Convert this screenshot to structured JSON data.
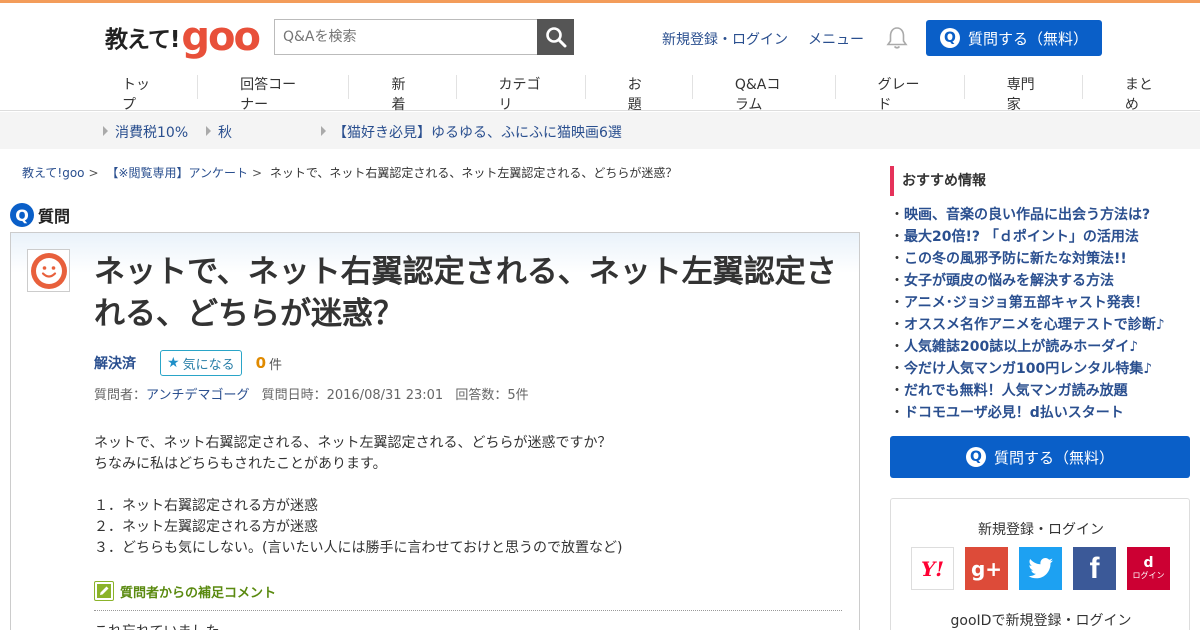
{
  "colors": {
    "accent_orange": "#f39c5a",
    "brand_blue": "#0a5fc8",
    "link": "#2a4f8f",
    "pink_bar": "#e5325a"
  },
  "header": {
    "logo_text": "教えて!",
    "logo_brand": "goo",
    "search_placeholder": "Q&Aを検索",
    "login_link": "新規登録・ログイン",
    "menu_link": "メニュー",
    "ask_button": "質問する（無料）"
  },
  "nav": [
    "トップ",
    "回答コーナー",
    "新着",
    "カテゴリ",
    "お題",
    "Q&Aコラム",
    "グレード",
    "専門家",
    "まとめ"
  ],
  "trend": [
    "消費税10%",
    "秋",
    "【猫好き必見】ゆるゆる、ふにふに猫映画6選"
  ],
  "breadcrumb": {
    "home": "教えて!goo",
    "category": "【※閲覧専用】アンケート",
    "current": "ネットで、ネット右翼認定される、ネット左翼認定される、どちらが迷惑？"
  },
  "question": {
    "section_label": "質問",
    "title": "ネットで、ネット右翼認定される、ネット左翼認定される、どちらが迷惑？",
    "status": "解決済",
    "kininaru_label": "気になる",
    "kininaru_count": "0",
    "kininaru_unit": "件",
    "meta_asker_label": "質問者：",
    "asker": "アンチデマゴーグ",
    "meta_date": "質問日時：2016/08/31 23:01",
    "meta_answers": "回答数：5件",
    "body": "ネットで、ネット右翼認定される、ネット左翼認定される、どちらが迷惑ですか？\nちなみに私はどちらもされたことがあります。\n\n１．ネット右翼認定される方が迷惑\n２．ネット左翼認定される方が迷惑\n３．どちらも気にしない。(言いたい人には勝手に言わせておけと思うので放置など)",
    "supplement_label": "質問者からの補足コメント",
    "supplement_text": "これ忘れていました"
  },
  "sidebar": {
    "recommend_title": "おすすめ情報",
    "recommend": [
      "映画、音楽の良い作品に出会う方法は?",
      "最大20倍!? 「ｄポイント」の活用法",
      "この冬の風邪予防に新たな対策法!!",
      "女子が頭皮の悩みを解決する方法",
      "アニメ･ジョジョ第五部キャスト発表！",
      "オススメ名作アニメを心理テストで診断♪",
      "人気雑誌200誌以上が読みホーダイ♪",
      "今だけ人気マンガ100円レンタル特集♪",
      "だれでも無料！人気マンガ読み放題",
      "ドコモユーザ必見！d払いスタート"
    ],
    "ask_button": "質問する（無料）",
    "login_title": "新規登録・ログイン",
    "sns": [
      {
        "icon": "yahoo-icon",
        "label": "Y!",
        "color": "#ffffff",
        "text_color": "#ff0033"
      },
      {
        "icon": "google-plus-icon",
        "label": "g+",
        "color": "#dd4b39",
        "text_color": "#ffffff"
      },
      {
        "icon": "twitter-icon",
        "label": "🐦",
        "color": "#1da1f2",
        "text_color": "#ffffff"
      },
      {
        "icon": "facebook-icon",
        "label": "f",
        "color": "#3b5998",
        "text_color": "#ffffff"
      },
      {
        "icon": "docomo-d-icon",
        "label": "d",
        "sub": "ログイン",
        "color": "#cc0033",
        "text_color": "#ffffff"
      }
    ],
    "goo_login": "gooIDで新規登録・ログイン"
  }
}
